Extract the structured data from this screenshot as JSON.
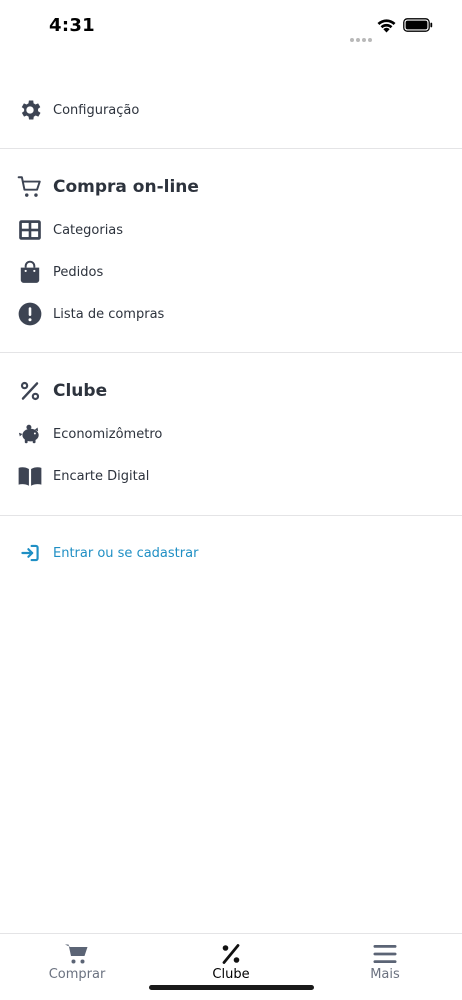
{
  "status_bar": {
    "time": "4:31"
  },
  "settings": {
    "label": "Configuração",
    "icon": "gear-icon"
  },
  "online_section": {
    "title": "Compra on-line",
    "icon": "cart-icon",
    "items": [
      {
        "label": "Categorias",
        "icon": "grid-icon"
      },
      {
        "label": "Pedidos",
        "icon": "shopping-bag-icon"
      },
      {
        "label": "Lista de compras",
        "icon": "exclamation-icon"
      }
    ]
  },
  "club_section": {
    "title": "Clube",
    "icon": "percent-icon",
    "items": [
      {
        "label": "Economizômetro",
        "icon": "piggy-bank-icon"
      },
      {
        "label": "Encarte Digital",
        "icon": "book-icon"
      }
    ]
  },
  "login": {
    "label": "Entrar ou se cadastrar",
    "icon": "sign-in-icon"
  },
  "tab_bar": {
    "tabs": [
      {
        "label": "Comprar",
        "icon": "cart-icon",
        "active": false
      },
      {
        "label": "Clube",
        "icon": "percent-icon",
        "active": true
      },
      {
        "label": "Mais",
        "icon": "hamburger-icon",
        "active": false
      }
    ]
  },
  "colors": {
    "text": "#2d333d",
    "link": "#1f8fc4",
    "divider": "#e4e4e6",
    "tab_inactive": "#6b7280",
    "tab_active": "#000000"
  }
}
